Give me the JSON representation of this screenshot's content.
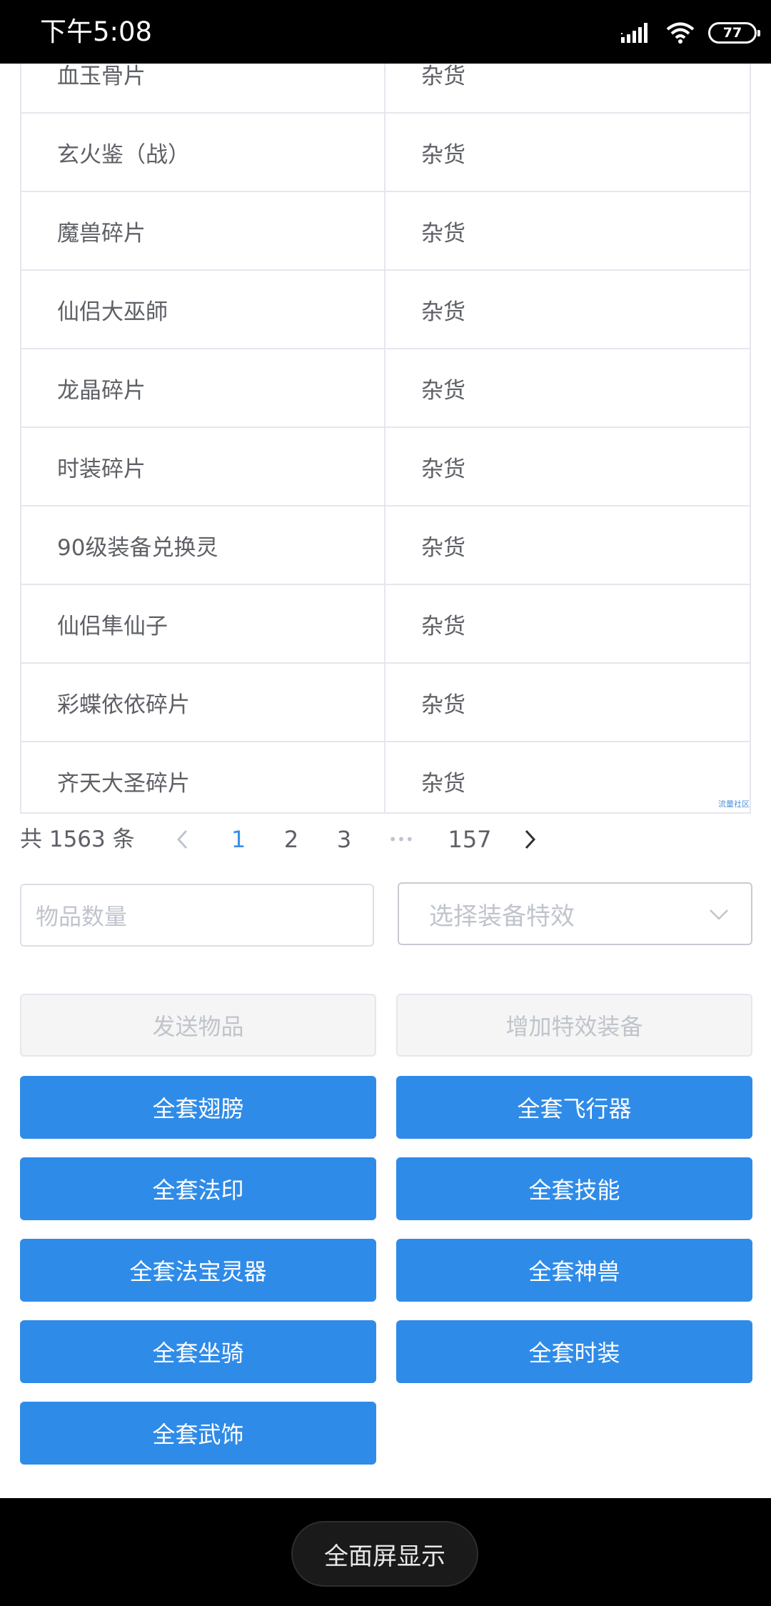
{
  "status_bar": {
    "time": "下午5:08",
    "battery": "77",
    "icons": [
      "signal-icon",
      "wifi-icon",
      "battery-icon"
    ]
  },
  "table": {
    "rows": [
      {
        "name": "血玉骨片",
        "type": "杂货"
      },
      {
        "name": "玄火鉴（战）",
        "type": "杂货"
      },
      {
        "name": "魔兽碎片",
        "type": "杂货"
      },
      {
        "name": "仙侣大巫師",
        "type": "杂货"
      },
      {
        "name": "龙晶碎片",
        "type": "杂货"
      },
      {
        "name": "时装碎片",
        "type": "杂货"
      },
      {
        "name": "90级装备兑换灵",
        "type": "杂货"
      },
      {
        "name": "仙侣隼仙子",
        "type": "杂货"
      },
      {
        "name": "彩蝶依依碎片",
        "type": "杂货"
      },
      {
        "name": "齐天大圣碎片",
        "type": "杂货"
      }
    ],
    "watermark": "流量社区"
  },
  "pagination": {
    "total": "共 1563 条",
    "pages": [
      "1",
      "2",
      "3",
      "157"
    ],
    "current": "1",
    "ellipsis": "•••",
    "prev_icon": "chevron-left-icon",
    "next_icon": "chevron-right-icon"
  },
  "form": {
    "quantity_placeholder": "物品数量",
    "effect_placeholder": "选择装备特效"
  },
  "buttons": {
    "send": "发送物品",
    "add_effect": "增加特效装备",
    "wings": "全套翅膀",
    "aircraft": "全套飞行器",
    "seal": "全套法印",
    "skills": "全套技能",
    "artifact": "全套法宝灵器",
    "beast": "全套神兽",
    "mount": "全套坐骑",
    "fashion": "全套时装",
    "weapon_ornament": "全套武饰"
  },
  "bottom_bar": {
    "fullscreen": "全面屏显示"
  },
  "colors": {
    "primary": "#2f8be8",
    "active_page": "#3b8ee8",
    "placeholder": "#c0c4cc",
    "border": "#e4e7ed"
  }
}
